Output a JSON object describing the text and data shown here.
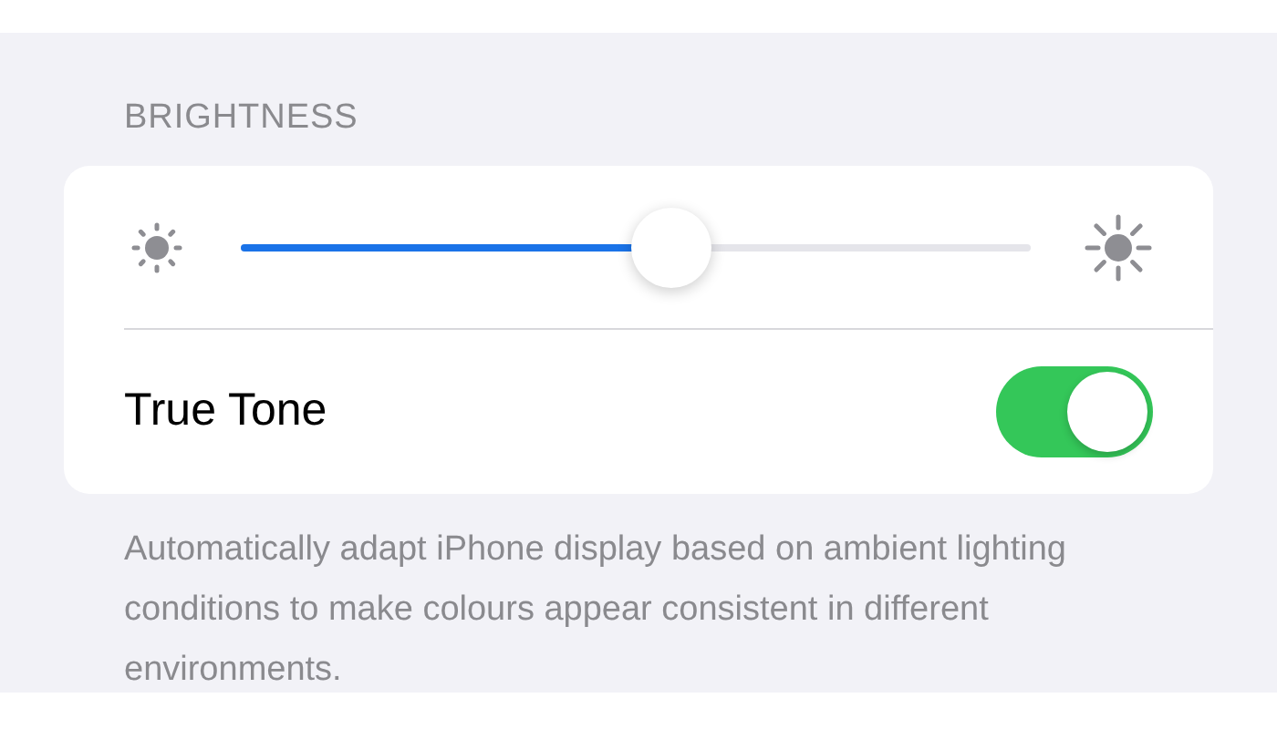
{
  "section_header": "BRIGHTNESS",
  "brightness": {
    "level": 0.545
  },
  "true_tone": {
    "label": "True Tone",
    "on": true
  },
  "footer": "Automatically adapt iPhone display based on ambient lighting conditions to make colours appear consistent in different environments."
}
